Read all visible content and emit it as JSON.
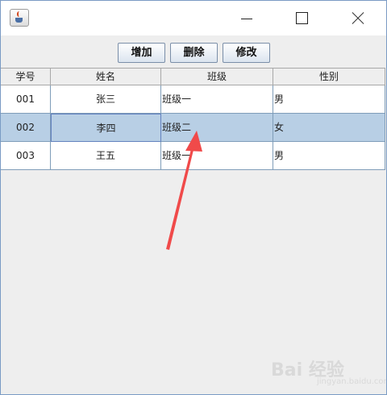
{
  "window": {
    "icon": "java-coffee-icon",
    "controls": [
      "minimize-icon",
      "maximize-icon",
      "close-icon"
    ]
  },
  "toolbar": {
    "add_label": "增加",
    "delete_label": "删除",
    "edit_label": "修改"
  },
  "table": {
    "columns": [
      "学号",
      "姓名",
      "班级",
      "性别"
    ],
    "rows": [
      [
        "001",
        "张三",
        "班级一",
        "男"
      ],
      [
        "002",
        "李四",
        "班级二",
        "女"
      ],
      [
        "003",
        "王五",
        "班级一",
        "男"
      ]
    ],
    "selected_row": 1
  },
  "colors": {
    "selection": "#b8cfe5",
    "grid": "#7f9db9",
    "annotation_arrow": "#f04a4a"
  },
  "watermark": {
    "text": "Bai 经验",
    "sub": "jingyan.baidu.com"
  }
}
